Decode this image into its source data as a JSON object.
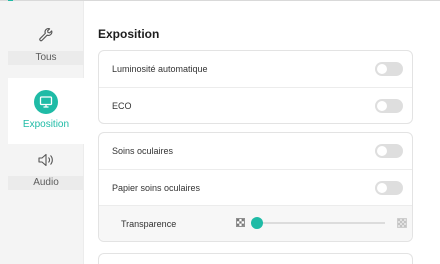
{
  "sidebar": {
    "items": [
      {
        "label": "Tous",
        "icon": "wrench-icon"
      },
      {
        "label": "Exposition",
        "icon": "monitor-icon"
      },
      {
        "label": "Audio",
        "icon": "speaker-icon"
      }
    ]
  },
  "section": {
    "title": "Exposition"
  },
  "card1": {
    "rows": [
      {
        "label": "Luminosité automatique",
        "enabled": false
      },
      {
        "label": "ECO",
        "enabled": false
      }
    ]
  },
  "card2": {
    "rows": [
      {
        "label": "Soins oculaires",
        "enabled": false
      },
      {
        "label": "Papier soins oculaires",
        "enabled": false
      }
    ],
    "transparence": {
      "label": "Transparence",
      "value_fraction": 0.0
    }
  },
  "colors": {
    "accent": "#1fbba6",
    "toggle_off": "#dedede",
    "sidebar_bg": "#f4f4f4"
  }
}
